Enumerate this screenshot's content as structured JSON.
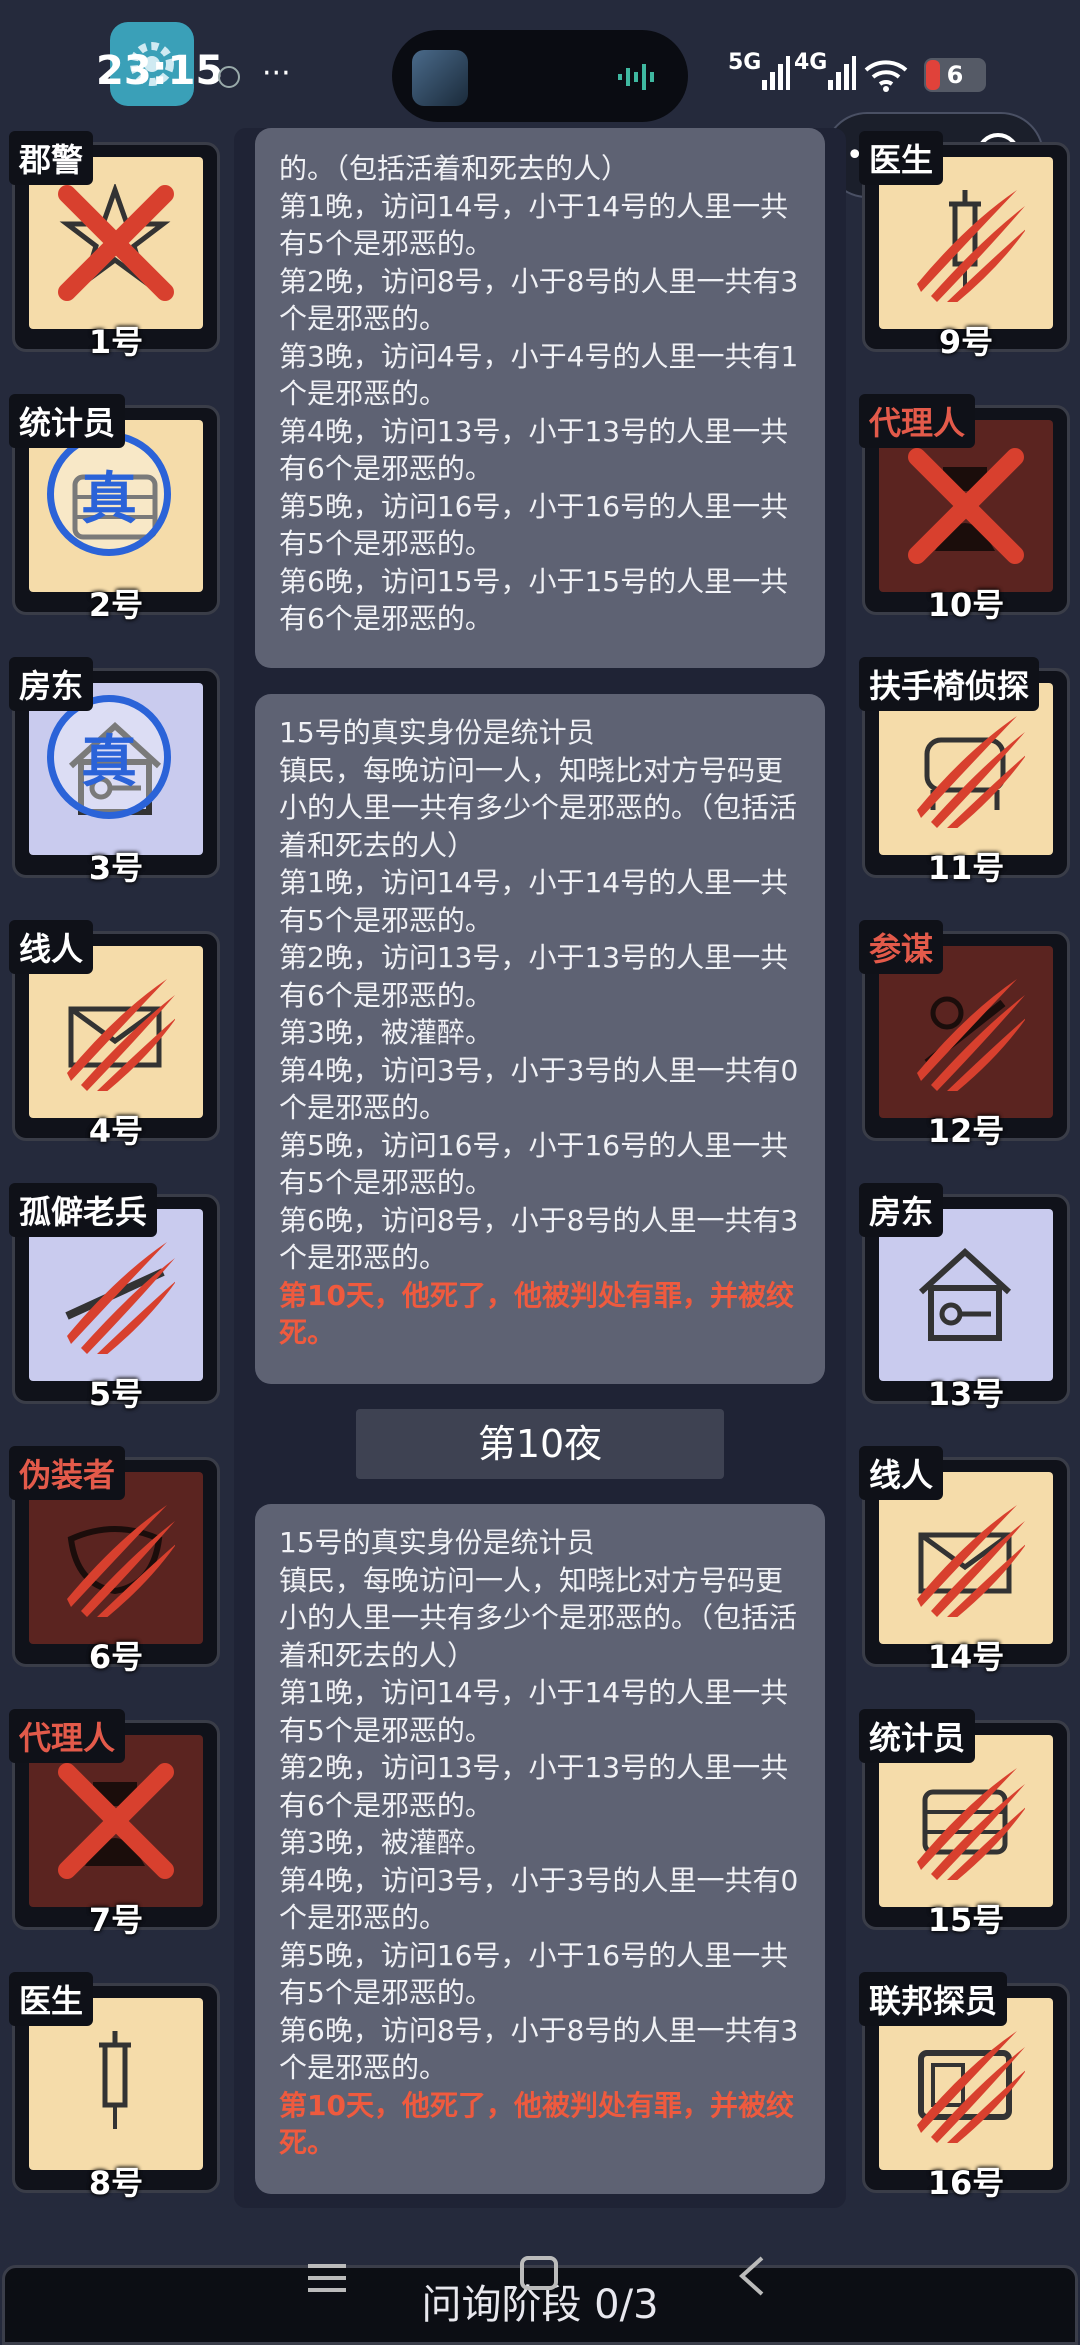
{
  "status": {
    "time": "23:15",
    "dots": "···",
    "network": "5G",
    "network2": "4G",
    "battery": "6"
  },
  "players_left": [
    {
      "role": "郡警",
      "num": "1号",
      "tone": "good",
      "mark": "cross",
      "role_color": "white",
      "icon": "sheriff-badge-icon"
    },
    {
      "role": "统计员",
      "num": "2号",
      "tone": "good",
      "mark": "true",
      "role_color": "white",
      "icon": "abacus-icon"
    },
    {
      "role": "房东",
      "num": "3号",
      "tone": "lav",
      "mark": "true",
      "role_color": "white",
      "icon": "house-key-icon"
    },
    {
      "role": "线人",
      "num": "4号",
      "tone": "good",
      "mark": "claw",
      "role_color": "white",
      "icon": "envelope-icon"
    },
    {
      "role": "孤僻老兵",
      "num": "5号",
      "tone": "lav",
      "mark": "claw",
      "role_color": "white",
      "icon": "rifle-icon"
    },
    {
      "role": "伪装者",
      "num": "6号",
      "tone": "evil",
      "mark": "claw",
      "role_color": "red",
      "icon": "mask-icon"
    },
    {
      "role": "代理人",
      "num": "7号",
      "tone": "evil",
      "mark": "cross",
      "role_color": "red",
      "icon": "agent-icon"
    },
    {
      "role": "医生",
      "num": "8号",
      "tone": "good",
      "mark": "none",
      "role_color": "white",
      "icon": "syringe-icon"
    }
  ],
  "players_right": [
    {
      "role": "医生",
      "num": "9号",
      "tone": "good",
      "mark": "claw",
      "role_color": "white",
      "icon": "syringe-icon"
    },
    {
      "role": "代理人",
      "num": "10号",
      "tone": "evil",
      "mark": "cross",
      "role_color": "red",
      "icon": "agent-icon"
    },
    {
      "role": "扶手椅侦探",
      "num": "11号",
      "tone": "good",
      "mark": "claw",
      "role_color": "white",
      "icon": "armchair-icon"
    },
    {
      "role": "参谋",
      "num": "12号",
      "tone": "evil",
      "mark": "claw",
      "role_color": "red",
      "icon": "strategist-icon"
    },
    {
      "role": "房东",
      "num": "13号",
      "tone": "lav",
      "mark": "none",
      "role_color": "white",
      "icon": "house-key-icon"
    },
    {
      "role": "线人",
      "num": "14号",
      "tone": "good",
      "mark": "claw",
      "role_color": "white",
      "icon": "envelope-icon"
    },
    {
      "role": "统计员",
      "num": "15号",
      "tone": "good",
      "mark": "claw",
      "role_color": "white",
      "icon": "abacus-icon"
    },
    {
      "role": "联邦探员",
      "num": "16号",
      "tone": "good",
      "mark": "claw",
      "role_color": "white",
      "icon": "badge-card-icon"
    }
  ],
  "true_mark": "真",
  "box1": {
    "lines": "的。（包括活着和死去的人）\n第1晚，访问14号，小于14号的人里一共有5个是邪恶的。\n第2晚，访问8号，小于8号的人里一共有3个是邪恶的。\n第3晚，访问4号，小于4号的人里一共有1个是邪恶的。\n第4晚，访问13号，小于13号的人里一共有6个是邪恶的。\n第5晚，访问16号，小于16号的人里一共有5个是邪恶的。\n第6晚，访问15号，小于15号的人里一共有6个是邪恶的。"
  },
  "box2": {
    "lines": "15号的真实身份是统计员\n镇民，每晚访问一人，知晓比对方号码更小的人里一共有多少个是邪恶的。（包括活着和死去的人）\n第1晚，访问14号，小于14号的人里一共有5个是邪恶的。\n第2晚，访问13号，小于13号的人里一共有6个是邪恶的。\n第3晚，被灌醉。\n第4晚，访问3号，小于3号的人里一共有0个是邪恶的。\n第5晚，访问16号，小于16号的人里一共有5个是邪恶的。\n第6晚，访问8号，小于8号的人里一共有3个是邪恶的。",
    "death": "第10天，他死了，他被判处有罪，并被绞死。"
  },
  "night_banner": "第10夜",
  "box3": {
    "lines": "15号的真实身份是统计员\n镇民，每晚访问一人，知晓比对方号码更小的人里一共有多少个是邪恶的。（包括活着和死去的人）\n第1晚，访问14号，小于14号的人里一共有5个是邪恶的。\n第2晚，访问13号，小于13号的人里一共有6个是邪恶的。\n第3晚，被灌醉。\n第4晚，访问3号，小于3号的人里一共有0个是邪恶的。\n第5晚，访问16号，小于16号的人里一共有5个是邪恶的。\n第6晚，访问8号，小于8号的人里一共有3个是邪恶的。",
    "death": "第10天，他死了，他被判处有罪，并被绞死。"
  },
  "bottom_bar": "问询阶段 0/3",
  "colors": {
    "evil_text": "#ef5a3e",
    "claw": "#d8402e"
  }
}
